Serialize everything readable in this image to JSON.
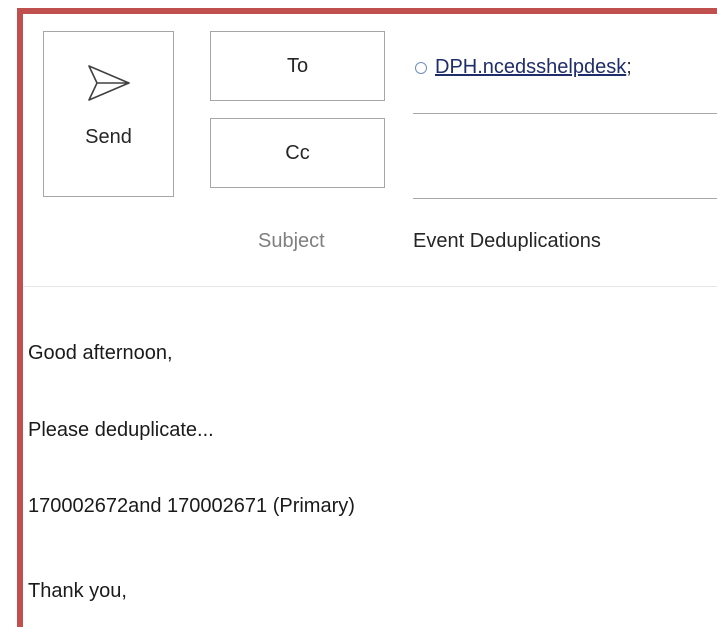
{
  "toolbar": {
    "send_label": "Send",
    "to_label": "To",
    "cc_label": "Cc",
    "subject_label": "Subject"
  },
  "message": {
    "to_recipient": "DPH.ncedsshelpdesk",
    "to_separator": ";",
    "cc_value": "",
    "subject": "Event Deduplications",
    "body": [
      "Good afternoon,",
      "Please deduplicate...",
      "170002672and 170002671 (Primary)",
      "Thank you,"
    ]
  },
  "icons": {
    "send": "send-arrow-icon",
    "presence": "presence-status-icon"
  },
  "colors": {
    "highlight_border": "#c0504d",
    "recipient_text": "#1f2d6b",
    "subject_label": "#7f7f7f"
  }
}
